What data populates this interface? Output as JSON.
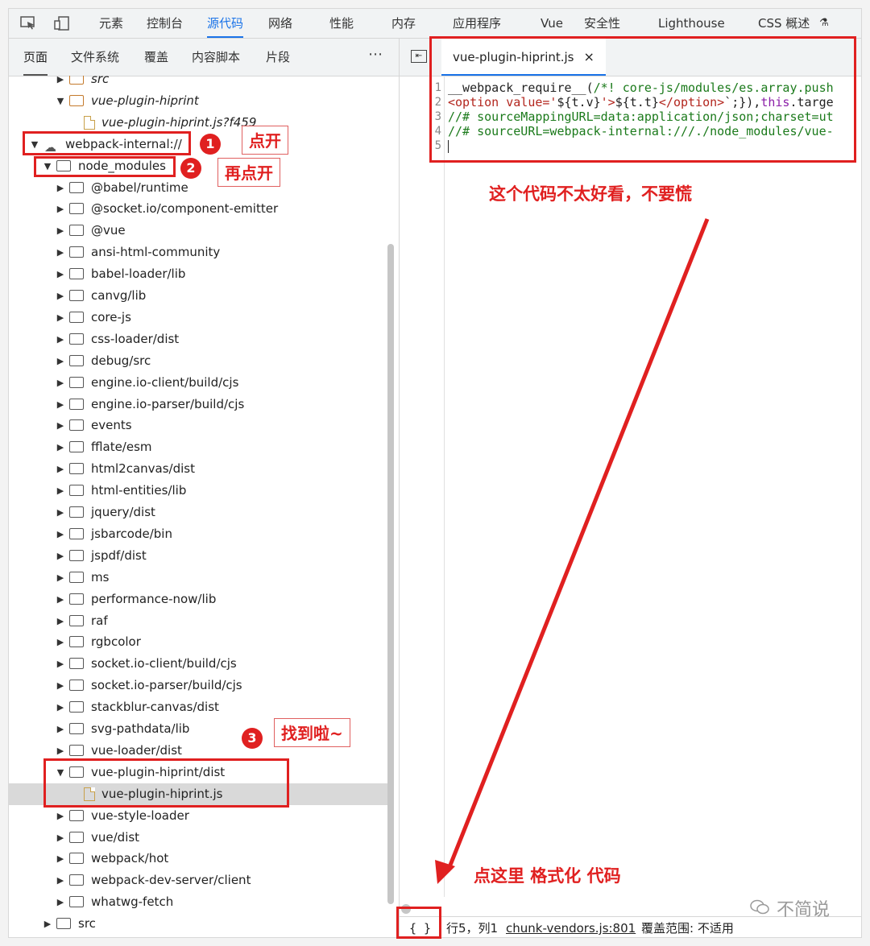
{
  "toolbar": {
    "tabs": [
      "元素",
      "控制台",
      "源代码",
      "网络",
      "性能",
      "内存",
      "应用程序",
      "Vue",
      "安全性",
      "Lighthouse",
      "CSS 概述"
    ],
    "active": "源代码"
  },
  "left_panel": {
    "subtabs": [
      "页面",
      "文件系统",
      "覆盖",
      "内容脚本",
      "片段"
    ],
    "active": "页面",
    "more_label": "⋯",
    "tree": [
      {
        "label": "src",
        "italic": true
      },
      {
        "label": "vue-plugin-hiprint",
        "italic": true
      },
      {
        "label": "vue-plugin-hiprint.js?f459",
        "italic": true
      },
      {
        "label": "webpack-internal://"
      },
      {
        "label": "node_modules"
      },
      {
        "label": "@babel/runtime"
      },
      {
        "label": "@socket.io/component-emitter"
      },
      {
        "label": "@vue"
      },
      {
        "label": "ansi-html-community"
      },
      {
        "label": "babel-loader/lib"
      },
      {
        "label": "canvg/lib"
      },
      {
        "label": "core-js"
      },
      {
        "label": "css-loader/dist"
      },
      {
        "label": "debug/src"
      },
      {
        "label": "engine.io-client/build/cjs"
      },
      {
        "label": "engine.io-parser/build/cjs"
      },
      {
        "label": "events"
      },
      {
        "label": "fflate/esm"
      },
      {
        "label": "html2canvas/dist"
      },
      {
        "label": "html-entities/lib"
      },
      {
        "label": "jquery/dist"
      },
      {
        "label": "jsbarcode/bin"
      },
      {
        "label": "jspdf/dist"
      },
      {
        "label": "ms"
      },
      {
        "label": "performance-now/lib"
      },
      {
        "label": "raf"
      },
      {
        "label": "rgbcolor"
      },
      {
        "label": "socket.io-client/build/cjs"
      },
      {
        "label": "socket.io-parser/build/cjs"
      },
      {
        "label": "stackblur-canvas/dist"
      },
      {
        "label": "svg-pathdata/lib"
      },
      {
        "label": "vue-loader/dist"
      },
      {
        "label": "vue-plugin-hiprint/dist"
      },
      {
        "label": "vue-plugin-hiprint.js"
      },
      {
        "label": "vue-style-loader"
      },
      {
        "label": "vue/dist"
      },
      {
        "label": "webpack/hot"
      },
      {
        "label": "webpack-dev-server/client"
      },
      {
        "label": "whatwg-fetch"
      },
      {
        "label": "src"
      }
    ]
  },
  "editor": {
    "tab_label": "vue-plugin-hiprint.js",
    "close_label": "×",
    "panel_toggle_label": "⇤",
    "line_numbers": [
      "1",
      "2",
      "3",
      "4",
      "5"
    ],
    "lines": [
      [
        "__webpack_require__(",
        "/*! core-js/modules/es.array.push"
      ],
      [
        "<option value='",
        "${t.v}",
        "'>",
        "${t.t}",
        "</option>",
        "`;}),",
        "this",
        ".targe"
      ],
      [
        "//# sourceMappingURL=data:application/json;charset=ut"
      ],
      [
        "//# sourceURL=webpack-internal:///./node_modules/vue-"
      ],
      [
        ""
      ]
    ]
  },
  "statusbar": {
    "format_label": "{ }",
    "position": "行5，列1",
    "source_link": "chunk-vendors.js:801",
    "coverage": "覆盖范围: 不适用"
  },
  "annotations": {
    "step1_number": "1",
    "step1_text": "点开",
    "step2_number": "2",
    "step2_text": "再点开",
    "step3_number": "3",
    "step3_text": "找到啦~",
    "code_note": "这个代码不太好看，不要慌",
    "format_note": "点这里 格式化 代码",
    "color": "#e02020"
  },
  "watermark": "不简说"
}
